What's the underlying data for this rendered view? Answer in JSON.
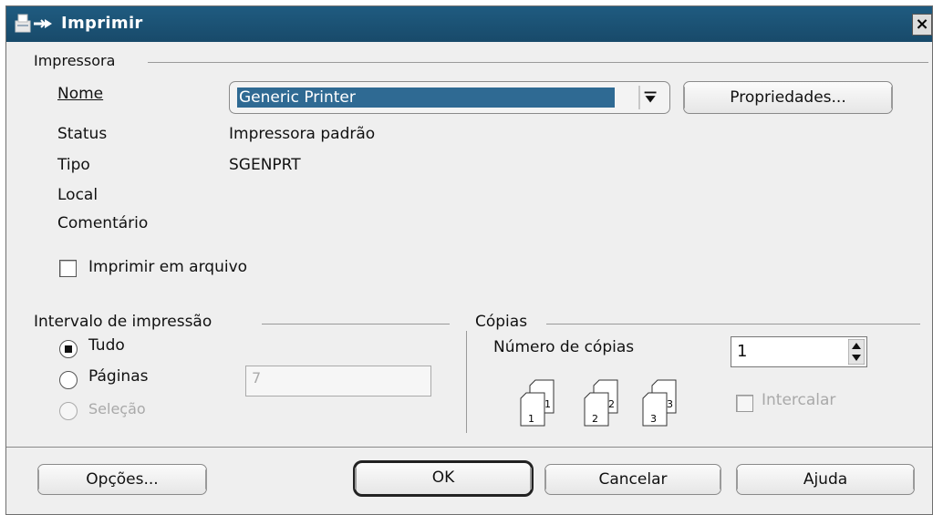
{
  "window": {
    "title": "Imprimir"
  },
  "printer": {
    "group_title": "Impressora",
    "name_label": "Nome",
    "name_value": "Generic Printer",
    "properties_button": "Propriedades...",
    "status_label": "Status",
    "status_value": "Impressora padrão",
    "type_label": "Tipo",
    "type_value": "SGENPRT",
    "location_label": "Local",
    "comment_label": "Comentário",
    "print_to_file_label": "Imprimir em arquivo"
  },
  "range": {
    "group_title": "Intervalo de impressão",
    "all_label": "Tudo",
    "pages_label": "Páginas",
    "pages_value": "7",
    "selection_label": "Seleção",
    "selected": "all"
  },
  "copies": {
    "group_title": "Cópias",
    "count_label": "Número de cópias",
    "count_value": "1",
    "collate_label": "Intercalar",
    "collate_icons": [
      {
        "front": "1",
        "back": "1"
      },
      {
        "front": "2",
        "back": "2"
      },
      {
        "front": "3",
        "back": "3"
      }
    ]
  },
  "buttons": {
    "options": "Opções...",
    "ok": "OK",
    "cancel": "Cancelar",
    "help": "Ajuda"
  },
  "colors": {
    "titlebar": "#1f5b80",
    "selection": "#2f6a93",
    "dialog_bg": "#efefef"
  }
}
